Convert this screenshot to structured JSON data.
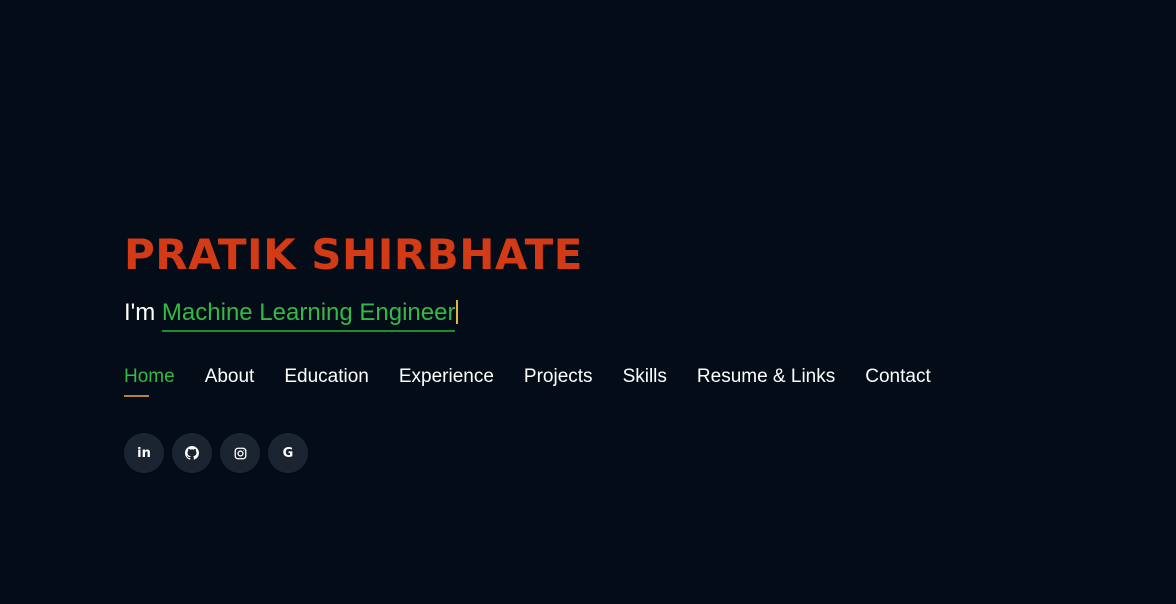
{
  "hero": {
    "name": "PRATIK SHIRBHATE",
    "tagline_prefix": "I'm",
    "tagline_typed": "Machine Learning Engineer"
  },
  "nav": {
    "items": [
      {
        "label": "Home",
        "active": true
      },
      {
        "label": "About"
      },
      {
        "label": "Education"
      },
      {
        "label": "Experience"
      },
      {
        "label": "Projects"
      },
      {
        "label": "Skills"
      },
      {
        "label": "Resume & Links"
      },
      {
        "label": "Contact"
      }
    ]
  },
  "social": {
    "items": [
      {
        "icon": "linkedin-icon",
        "glyph": "in"
      },
      {
        "icon": "github-icon"
      },
      {
        "icon": "instagram-icon"
      },
      {
        "icon": "google-icon",
        "glyph": "G"
      }
    ]
  },
  "colors": {
    "background": "#040c18",
    "name": "#d33a16",
    "accent_green": "#33b947",
    "nav_underline": "#b5833b",
    "cursor": "#e9b33a",
    "social_bg": "#1b2431"
  }
}
